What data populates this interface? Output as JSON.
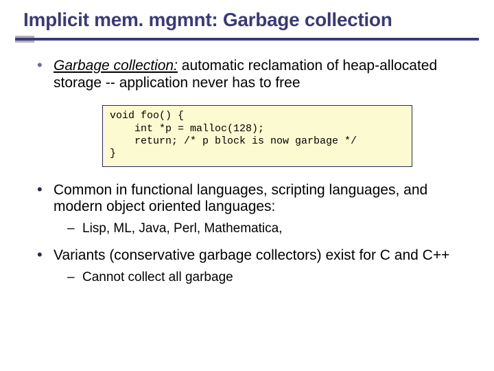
{
  "title": "Implicit mem. mgmnt: Garbage collection",
  "bullets": {
    "b1_term": "Garbage collection:",
    "b1_rest": " automatic reclamation of heap-allocated storage -- application never has to free",
    "code": "void foo() {\n    int *p = malloc(128);\n    return; /* p block is now garbage */\n}",
    "b2": "Common in functional languages, scripting languages, and modern object oriented languages:",
    "b2_sub": "Lisp, ML, Java, Perl, Mathematica,",
    "b3": "Variants (conservative garbage collectors) exist for C and C++",
    "b3_sub": "Cannot collect all garbage"
  }
}
